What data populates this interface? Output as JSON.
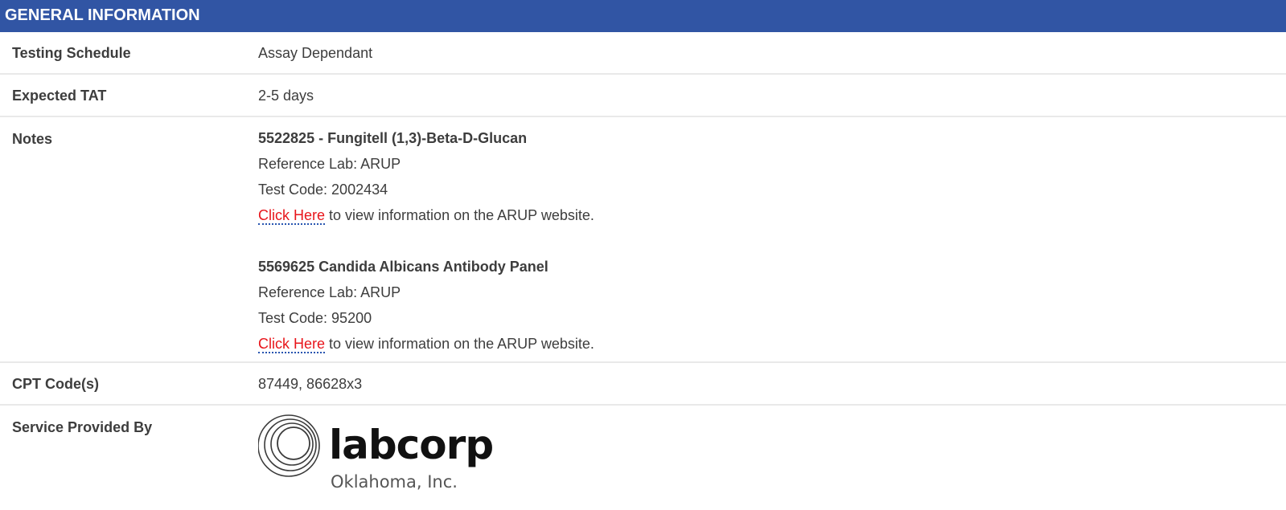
{
  "header": {
    "title": "GENERAL INFORMATION"
  },
  "rows": {
    "testing_schedule": {
      "label": "Testing Schedule",
      "value": "Assay Dependant"
    },
    "expected_tat": {
      "label": "Expected TAT",
      "value": "2-5 days"
    },
    "notes": {
      "label": "Notes",
      "entries": [
        {
          "title": "5522825 - Fungitell (1,3)-Beta-D-Glucan",
          "reference_lab": "Reference Lab: ARUP",
          "test_code": "Test Code: 2002434",
          "link_text": "Click Here",
          "link_suffix": " to view information on the ARUP website."
        },
        {
          "title": "5569625 Candida Albicans Antibody Panel",
          "reference_lab": "Reference Lab: ARUP",
          "test_code": "Test Code: 95200",
          "link_text": "Click Here",
          "link_suffix": " to view information on the ARUP website."
        }
      ]
    },
    "cpt_codes": {
      "label": "CPT Code(s)",
      "value": "87449, 86628x3"
    },
    "service_provided_by": {
      "label": "Service Provided By",
      "logo_name": "labcorp",
      "logo_subtitle": "Oklahoma, Inc."
    }
  },
  "colors": {
    "header_bg": "#3155a4",
    "link": "#e8151b",
    "link_underline": "#2855b0"
  }
}
